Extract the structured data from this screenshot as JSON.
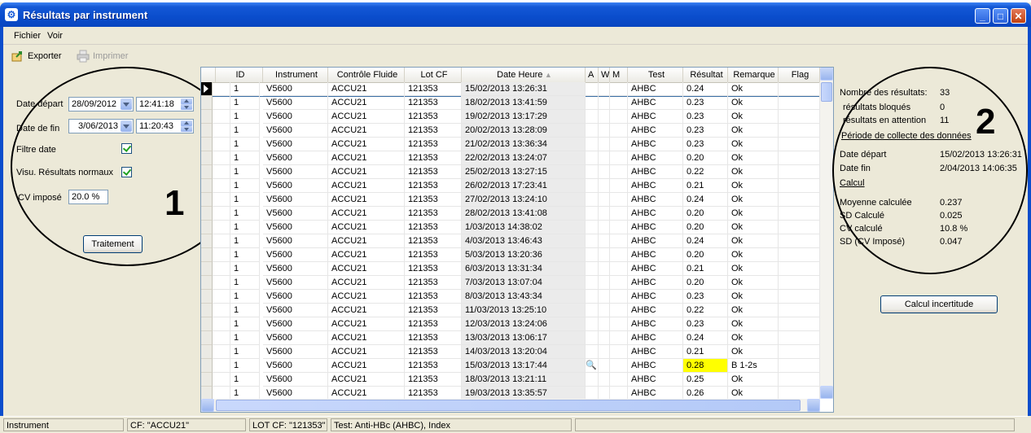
{
  "window": {
    "title": "Résultats par instrument"
  },
  "menu": {
    "items": [
      "Fichier",
      "Voir"
    ]
  },
  "toolbar": {
    "export_label": "Exporter",
    "print_label": "Imprimer"
  },
  "filters": {
    "date_depart_label": "Date départ",
    "date_depart_value": "28/09/2012",
    "time_depart_value": "12:41:18",
    "date_fin_label": "Date de fin",
    "date_fin_value": "3/06/2013",
    "time_fin_value": "11:20:43",
    "filtre_date_label": "Filtre date",
    "filtre_date_checked": true,
    "visu_label": "Visu. Résultats normaux",
    "visu_checked": true,
    "cv_label": "CV imposé",
    "cv_value": "20.0 %",
    "process_button": "Traitement",
    "annotation_number": "1"
  },
  "grid": {
    "columns": [
      "ID",
      "Instrument",
      "Contrôle Fluide",
      "Lot CF",
      "Date Heure",
      "A",
      "W",
      "M",
      "Test",
      "Résultat",
      "Remarque",
      "Flag"
    ],
    "sorted_column": "Date Heure",
    "rows": [
      {
        "id": "1",
        "instrument": "V5600",
        "controle": "ACCU21",
        "lot": "121353",
        "date": "15/02/2013 13:26:31",
        "a": "",
        "w": "",
        "m": "",
        "test": "AHBC",
        "resultat": "0.24",
        "remarque": "Ok",
        "flag": "",
        "current": true
      },
      {
        "id": "1",
        "instrument": "V5600",
        "controle": "ACCU21",
        "lot": "121353",
        "date": "18/02/2013 13:41:59",
        "a": "",
        "w": "",
        "m": "",
        "test": "AHBC",
        "resultat": "0.23",
        "remarque": "Ok",
        "flag": ""
      },
      {
        "id": "1",
        "instrument": "V5600",
        "controle": "ACCU21",
        "lot": "121353",
        "date": "19/02/2013 13:17:29",
        "a": "",
        "w": "",
        "m": "",
        "test": "AHBC",
        "resultat": "0.23",
        "remarque": "Ok",
        "flag": ""
      },
      {
        "id": "1",
        "instrument": "V5600",
        "controle": "ACCU21",
        "lot": "121353",
        "date": "20/02/2013 13:28:09",
        "a": "",
        "w": "",
        "m": "",
        "test": "AHBC",
        "resultat": "0.23",
        "remarque": "Ok",
        "flag": ""
      },
      {
        "id": "1",
        "instrument": "V5600",
        "controle": "ACCU21",
        "lot": "121353",
        "date": "21/02/2013 13:36:34",
        "a": "",
        "w": "",
        "m": "",
        "test": "AHBC",
        "resultat": "0.23",
        "remarque": "Ok",
        "flag": ""
      },
      {
        "id": "1",
        "instrument": "V5600",
        "controle": "ACCU21",
        "lot": "121353",
        "date": "22/02/2013 13:24:07",
        "a": "",
        "w": "",
        "m": "",
        "test": "AHBC",
        "resultat": "0.20",
        "remarque": "Ok",
        "flag": ""
      },
      {
        "id": "1",
        "instrument": "V5600",
        "controle": "ACCU21",
        "lot": "121353",
        "date": "25/02/2013 13:27:15",
        "a": "",
        "w": "",
        "m": "",
        "test": "AHBC",
        "resultat": "0.22",
        "remarque": "Ok",
        "flag": ""
      },
      {
        "id": "1",
        "instrument": "V5600",
        "controle": "ACCU21",
        "lot": "121353",
        "date": "26/02/2013 17:23:41",
        "a": "",
        "w": "",
        "m": "",
        "test": "AHBC",
        "resultat": "0.21",
        "remarque": "Ok",
        "flag": ""
      },
      {
        "id": "1",
        "instrument": "V5600",
        "controle": "ACCU21",
        "lot": "121353",
        "date": "27/02/2013 13:24:10",
        "a": "",
        "w": "",
        "m": "",
        "test": "AHBC",
        "resultat": "0.24",
        "remarque": "Ok",
        "flag": ""
      },
      {
        "id": "1",
        "instrument": "V5600",
        "controle": "ACCU21",
        "lot": "121353",
        "date": "28/02/2013 13:41:08",
        "a": "",
        "w": "",
        "m": "",
        "test": "AHBC",
        "resultat": "0.20",
        "remarque": "Ok",
        "flag": ""
      },
      {
        "id": "1",
        "instrument": "V5600",
        "controle": "ACCU21",
        "lot": "121353",
        "date": "1/03/2013 14:38:02",
        "a": "",
        "w": "",
        "m": "",
        "test": "AHBC",
        "resultat": "0.20",
        "remarque": "Ok",
        "flag": ""
      },
      {
        "id": "1",
        "instrument": "V5600",
        "controle": "ACCU21",
        "lot": "121353",
        "date": "4/03/2013 13:46:43",
        "a": "",
        "w": "",
        "m": "",
        "test": "AHBC",
        "resultat": "0.24",
        "remarque": "Ok",
        "flag": ""
      },
      {
        "id": "1",
        "instrument": "V5600",
        "controle": "ACCU21",
        "lot": "121353",
        "date": "5/03/2013 13:20:36",
        "a": "",
        "w": "",
        "m": "",
        "test": "AHBC",
        "resultat": "0.20",
        "remarque": "Ok",
        "flag": ""
      },
      {
        "id": "1",
        "instrument": "V5600",
        "controle": "ACCU21",
        "lot": "121353",
        "date": "6/03/2013 13:31:34",
        "a": "",
        "w": "",
        "m": "",
        "test": "AHBC",
        "resultat": "0.21",
        "remarque": "Ok",
        "flag": ""
      },
      {
        "id": "1",
        "instrument": "V5600",
        "controle": "ACCU21",
        "lot": "121353",
        "date": "7/03/2013 13:07:04",
        "a": "",
        "w": "",
        "m": "",
        "test": "AHBC",
        "resultat": "0.20",
        "remarque": "Ok",
        "flag": ""
      },
      {
        "id": "1",
        "instrument": "V5600",
        "controle": "ACCU21",
        "lot": "121353",
        "date": "8/03/2013 13:43:34",
        "a": "",
        "w": "",
        "m": "",
        "test": "AHBC",
        "resultat": "0.23",
        "remarque": "Ok",
        "flag": ""
      },
      {
        "id": "1",
        "instrument": "V5600",
        "controle": "ACCU21",
        "lot": "121353",
        "date": "11/03/2013 13:25:10",
        "a": "",
        "w": "",
        "m": "",
        "test": "AHBC",
        "resultat": "0.22",
        "remarque": "Ok",
        "flag": ""
      },
      {
        "id": "1",
        "instrument": "V5600",
        "controle": "ACCU21",
        "lot": "121353",
        "date": "12/03/2013 13:24:06",
        "a": "",
        "w": "",
        "m": "",
        "test": "AHBC",
        "resultat": "0.23",
        "remarque": "Ok",
        "flag": ""
      },
      {
        "id": "1",
        "instrument": "V5600",
        "controle": "ACCU21",
        "lot": "121353",
        "date": "13/03/2013 13:06:17",
        "a": "",
        "w": "",
        "m": "",
        "test": "AHBC",
        "resultat": "0.24",
        "remarque": "Ok",
        "flag": ""
      },
      {
        "id": "1",
        "instrument": "V5600",
        "controle": "ACCU21",
        "lot": "121353",
        "date": "14/03/2013 13:20:04",
        "a": "",
        "w": "",
        "m": "",
        "test": "AHBC",
        "resultat": "0.21",
        "remarque": "Ok",
        "flag": ""
      },
      {
        "id": "1",
        "instrument": "V5600",
        "controle": "ACCU21",
        "lot": "121353",
        "date": "15/03/2013 13:17:44",
        "a": "magnifier-icon",
        "w": "",
        "m": "",
        "test": "AHBC",
        "resultat": "0.28",
        "remarque": "B 1-2s",
        "flag": "",
        "highlight": true
      },
      {
        "id": "1",
        "instrument": "V5600",
        "controle": "ACCU21",
        "lot": "121353",
        "date": "18/03/2013 13:21:11",
        "a": "",
        "w": "",
        "m": "",
        "test": "AHBC",
        "resultat": "0.25",
        "remarque": "Ok",
        "flag": ""
      },
      {
        "id": "1",
        "instrument": "V5600",
        "controle": "ACCU21",
        "lot": "121353",
        "date": "19/03/2013 13:35:57",
        "a": "",
        "w": "",
        "m": "",
        "test": "AHBC",
        "resultat": "0.26",
        "remarque": "Ok",
        "flag": ""
      }
    ]
  },
  "summary": {
    "count_label": "Nombre des résultats:",
    "count_value": "33",
    "blocked_label": "résultats bloqués",
    "blocked_value": "0",
    "pending_label": "résultats en attention",
    "pending_value": "11",
    "period_link": "Période de collecte des données",
    "start_label": "Date départ",
    "start_value": "15/02/2013 13:26:31",
    "end_label": "Date fin",
    "end_value": "2/04/2013 14:06:35",
    "calc_link": "Calcul",
    "mean_label": "Moyenne calculée",
    "mean_value": "0.237",
    "sd_label": "SD Calculé",
    "sd_value": "0.025",
    "cv_label": "CV calculé",
    "cv_value": "10.8 %",
    "sdcv_label": "SD (CV Imposé)",
    "sdcv_value": "0.047",
    "uncertainty_button": "Calcul incertitude",
    "annotation_number": "2"
  },
  "statusbar": {
    "instrument": "Instrument",
    "cf": "CF: \"ACCU21\"",
    "lot": "LOT CF: \"121353\"",
    "test": "Test: Anti-HBc (AHBC), Index"
  },
  "colors": {
    "title_blue": "#0a4dcc",
    "highlight_yellow": "#ffff00",
    "check_green": "#21a121"
  }
}
